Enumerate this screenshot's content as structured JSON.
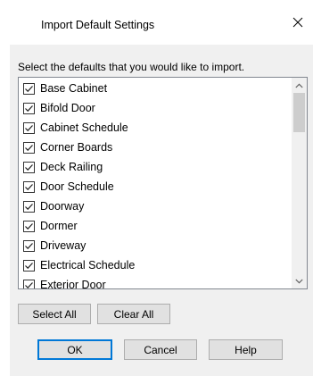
{
  "window": {
    "title": "Import Default Settings",
    "close_icon": "close-icon"
  },
  "instruction": "Select the defaults that you would like to import.",
  "list": {
    "items": [
      {
        "label": "Base Cabinet",
        "checked": true
      },
      {
        "label": "Bifold Door",
        "checked": true
      },
      {
        "label": "Cabinet Schedule",
        "checked": true
      },
      {
        "label": "Corner Boards",
        "checked": true
      },
      {
        "label": "Deck Railing",
        "checked": true
      },
      {
        "label": "Door Schedule",
        "checked": true
      },
      {
        "label": "Doorway",
        "checked": true
      },
      {
        "label": "Dormer",
        "checked": true
      },
      {
        "label": "Driveway",
        "checked": true
      },
      {
        "label": "Electrical Schedule",
        "checked": true
      },
      {
        "label": "Exterior Door",
        "checked": true
      }
    ],
    "scroll_up_icon": "chevron-up-icon",
    "scroll_down_icon": "chevron-down-icon"
  },
  "buttons": {
    "select_all": "Select All",
    "clear_all": "Clear All",
    "ok": "OK",
    "cancel": "Cancel",
    "help": "Help"
  },
  "colors": {
    "accent": "#0078d7",
    "dialog_bg": "#f0f0f0",
    "button_bg": "#e1e1e1"
  }
}
